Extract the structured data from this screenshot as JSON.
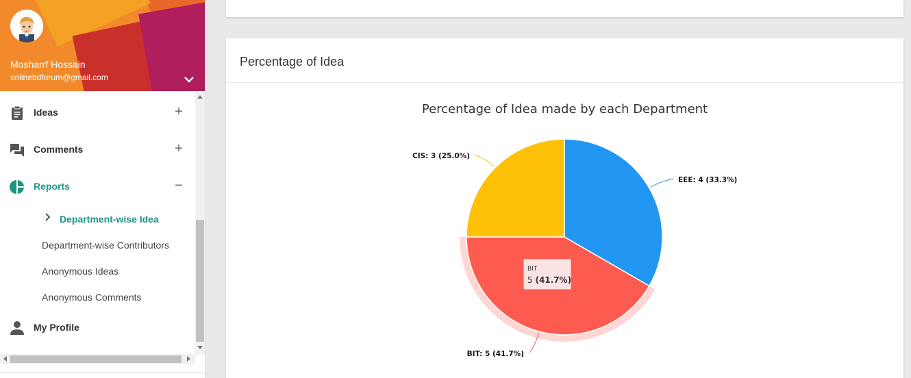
{
  "sidebar": {
    "user": {
      "name": "Mosharrf Hossain",
      "email": "onlinebdforum@gmail.com"
    },
    "menu": [
      {
        "label": "Ideas",
        "icon": "clipboard-icon",
        "toggle": "+"
      },
      {
        "label": "Comments",
        "icon": "forum-icon",
        "toggle": "+"
      },
      {
        "label": "Reports",
        "icon": "pie-chart-icon",
        "toggle": "−"
      },
      {
        "label": "My Profile",
        "icon": "person-icon",
        "toggle": ""
      }
    ],
    "reports_sub": [
      {
        "label": "Department-wise Idea",
        "active": true
      },
      {
        "label": "Department-wise Contributors"
      },
      {
        "label": "Anonymous Ideas"
      },
      {
        "label": "Anonymous Comments"
      }
    ]
  },
  "card": {
    "title": "Percentage of Idea"
  },
  "colors": {
    "accent": "#1f9485",
    "eee": "#2196f3",
    "bit": "#fe5b50",
    "cis": "#ffc107"
  },
  "chart_data": {
    "type": "pie",
    "title": "Percentage of Idea made by each Department",
    "slices": [
      {
        "name": "EEE",
        "value": 4,
        "percent": 33.3,
        "label": "EEE: 4 (33.3%)"
      },
      {
        "name": "BIT",
        "value": 5,
        "percent": 41.7,
        "label": "BIT: 5 (41.7%)"
      },
      {
        "name": "CIS",
        "value": 3,
        "percent": 25.0,
        "label": "CIS: 3 (25.0%)"
      }
    ],
    "tooltip": {
      "name": "BIT",
      "value": "5",
      "percent": "(41.7%)"
    }
  }
}
